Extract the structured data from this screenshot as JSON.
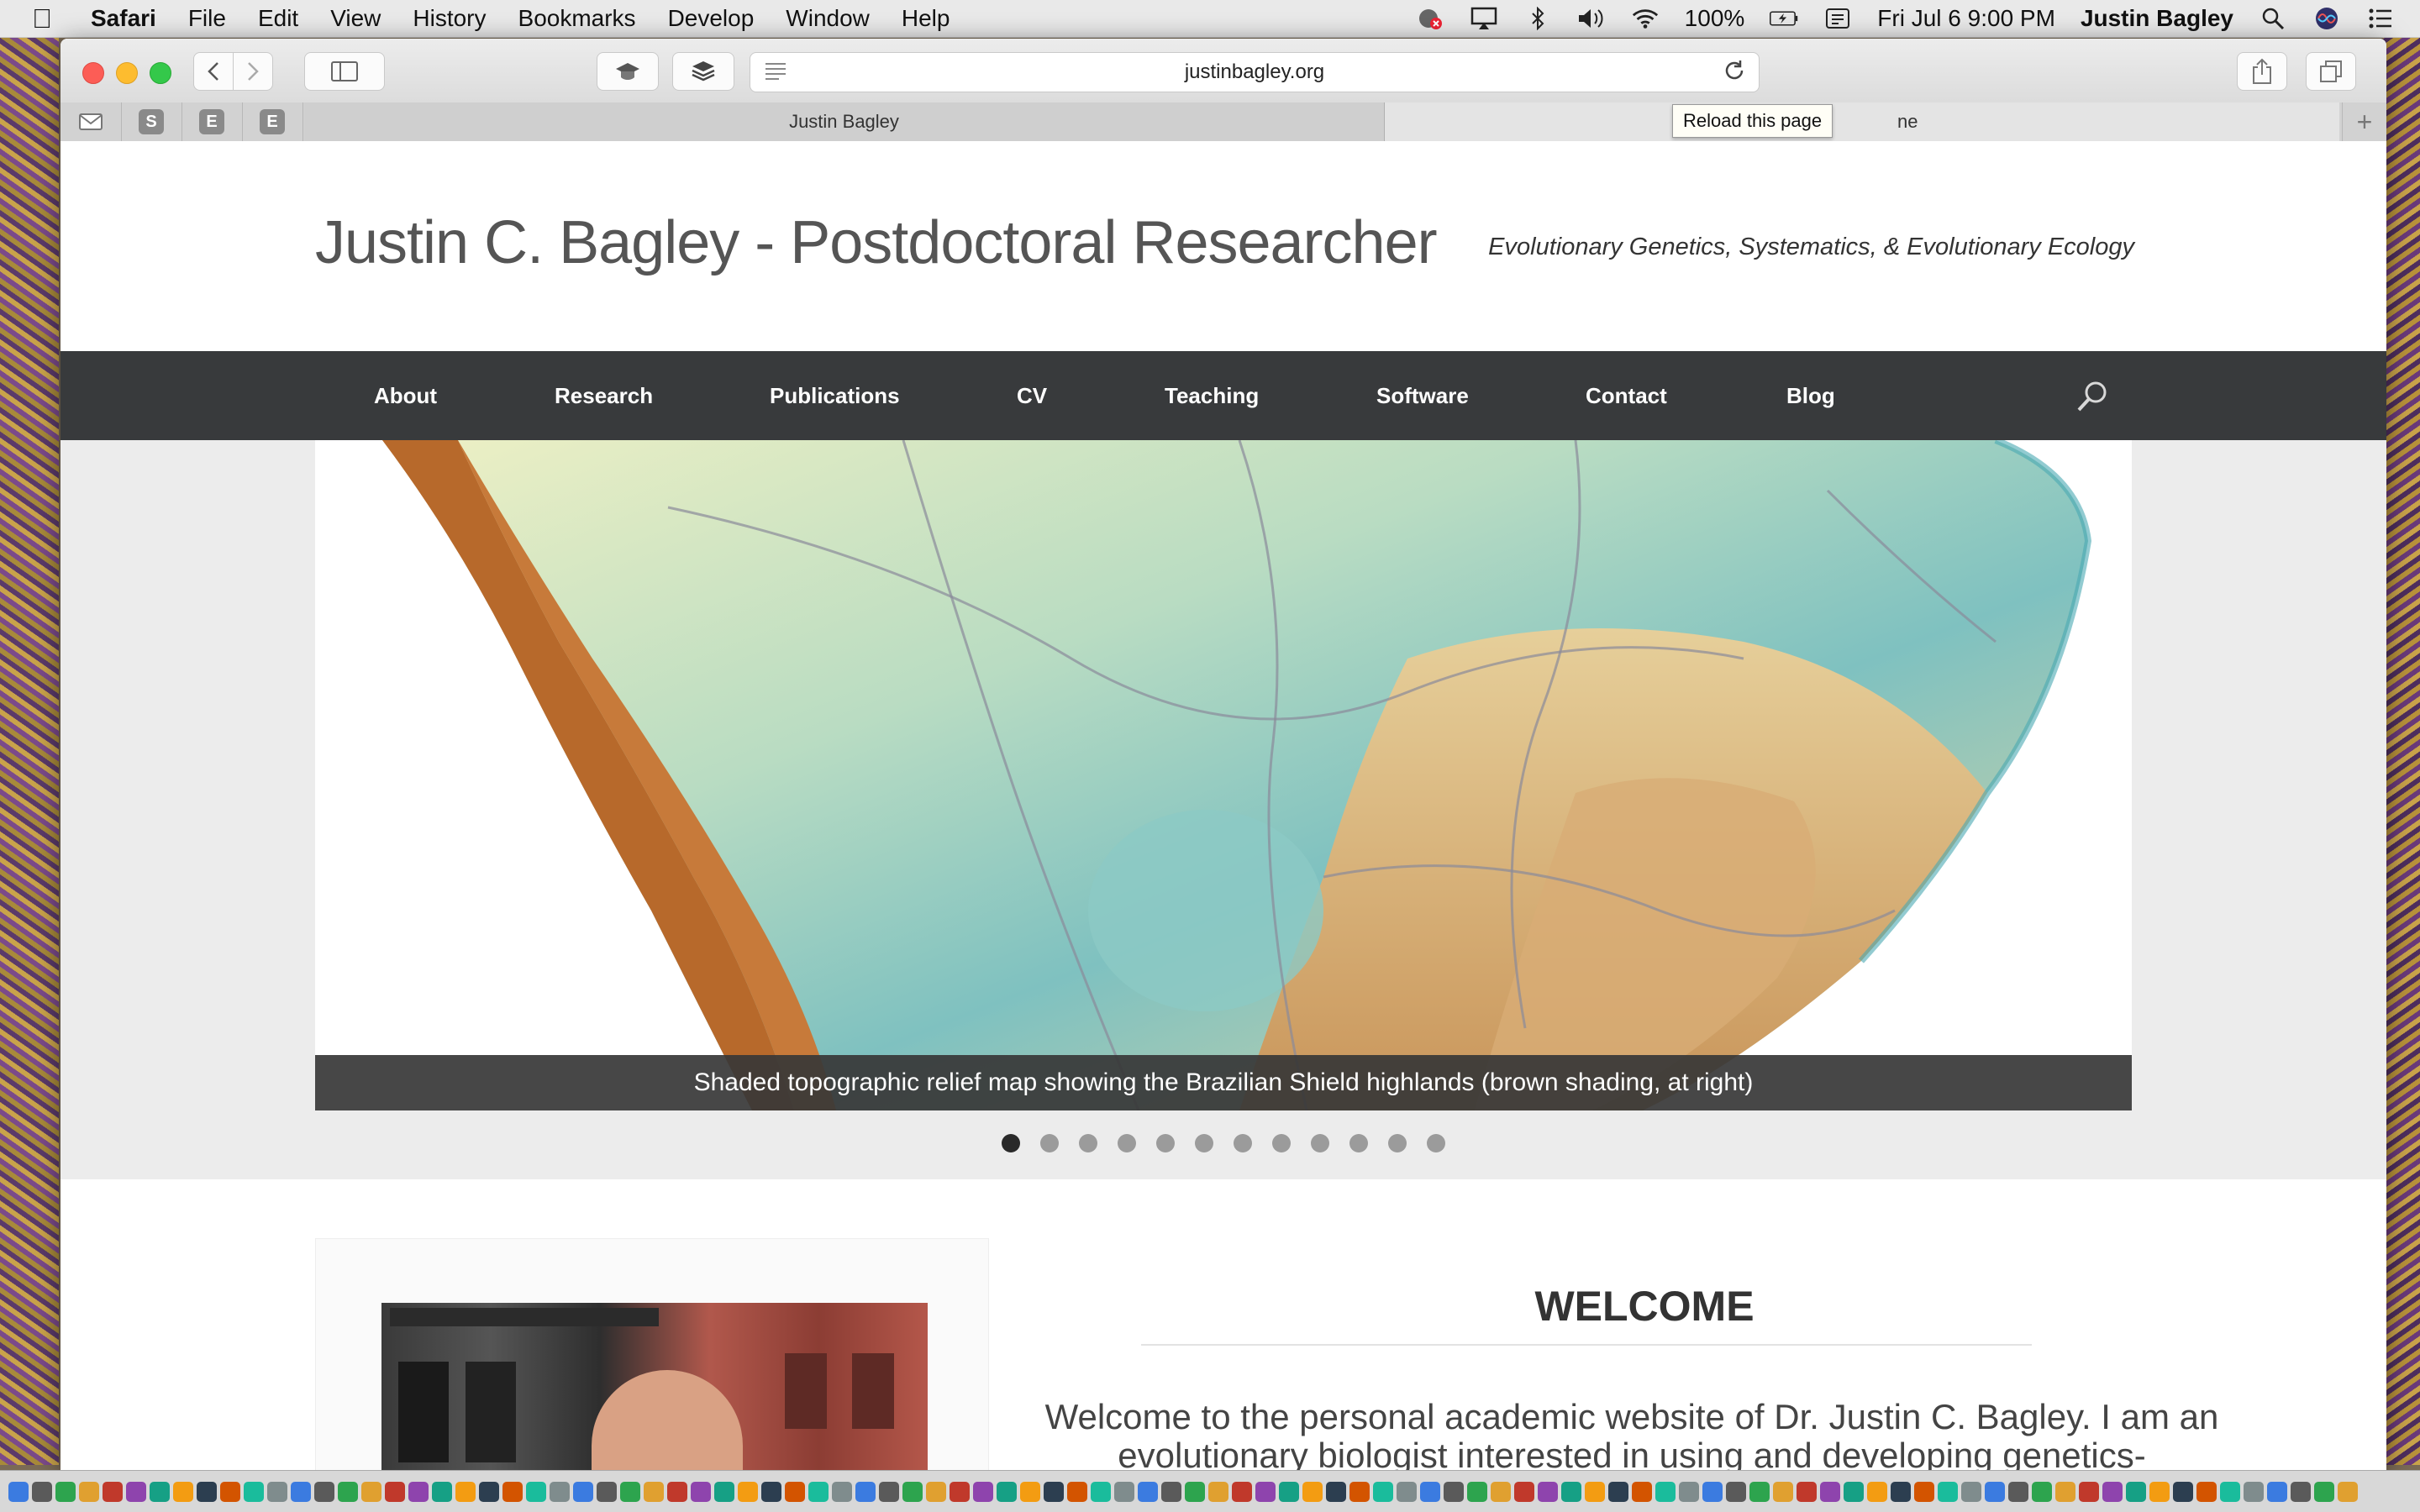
{
  "menubar": {
    "app": "Safari",
    "items": [
      "File",
      "Edit",
      "View",
      "History",
      "Bookmarks",
      "Develop",
      "Window",
      "Help"
    ],
    "battery": "100%",
    "datetime": "Fri Jul 6  9:00 PM",
    "user": "Justin Bagley"
  },
  "browser": {
    "url": "justinbagley.org",
    "pinned_tabs": [
      "S",
      "E",
      "E"
    ],
    "tabs": [
      {
        "label": "Justin Bagley",
        "active": true
      },
      {
        "label": "ne",
        "active": false
      }
    ],
    "tooltip": "Reload this page"
  },
  "site": {
    "title": "Justin C. Bagley - Postdoctoral Researcher",
    "tagline": "Evolutionary Genetics, Systematics, & Evolutionary Ecology",
    "nav": [
      "About",
      "Research",
      "Publications",
      "CV",
      "Teaching",
      "Software",
      "Contact",
      "Blog"
    ],
    "slider": {
      "caption": "Shaded topographic relief map showing the Brazilian Shield highlands (brown shading, at right)",
      "slide_count": 12,
      "active_index": 0
    },
    "welcome": {
      "heading": "WELCOME",
      "text": "Welcome to the personal academic website of Dr. Justin C. Bagley. I am an evolutionary biologist interested in using and developing genetics-"
    }
  },
  "colors": {
    "nav_bg": "#383a3c",
    "caption_bg": "#373737",
    "dot_active": "#2a2a2a",
    "dot_inactive": "#9b9b9b"
  }
}
